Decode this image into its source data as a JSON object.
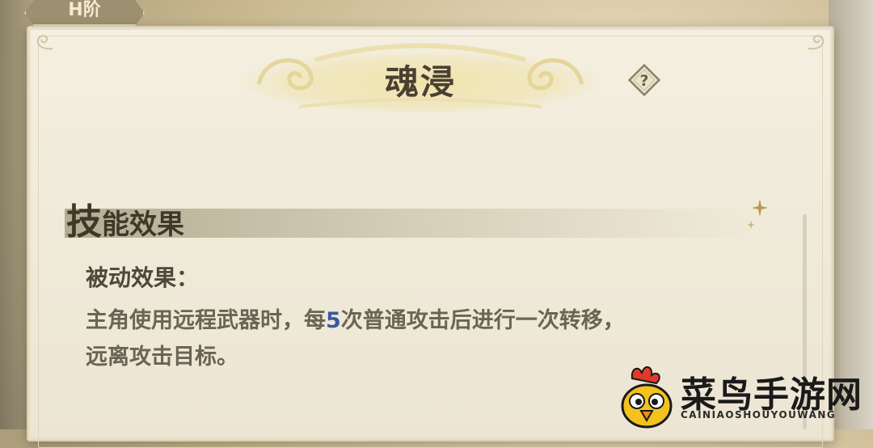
{
  "top_tab": {
    "label": "H阶"
  },
  "panel": {
    "title": "魂浸",
    "help_icon": "question-diamond-icon",
    "section_title_first": "技",
    "section_title_rest": "能效果",
    "subheading": "被动效果：",
    "desc_part1": "主角使用远程武器时，每",
    "desc_highlight": "5",
    "desc_part2": "次普通攻击后进行一次转移，",
    "desc_line2": "远离攻击目标。"
  },
  "colors": {
    "highlight": "#3a5aa0",
    "title": "#4a4030",
    "text": "#6a6454"
  },
  "watermark": {
    "name": "菜鸟手游网",
    "url_text": "CAINIAOSHOUYOUWANG",
    "icon": "chicken-mascot-icon"
  }
}
